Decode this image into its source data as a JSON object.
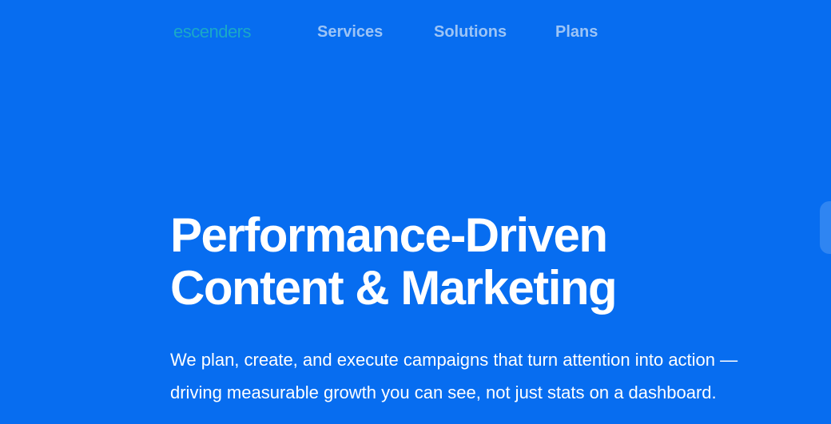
{
  "nav": {
    "logo": "escenders",
    "links": [
      {
        "label": "Services"
      },
      {
        "label": "Solutions"
      },
      {
        "label": "Plans"
      }
    ]
  },
  "hero": {
    "title_line1": "Performance-Driven",
    "title_line2": "Content & Marketing",
    "subtitle_line1": "We plan, create, and execute campaigns that turn attention into action —",
    "subtitle_line2": "driving measurable growth you can see, not just stats on a dashboard."
  },
  "colors": {
    "background": "#076df0",
    "logo": "#1aa8c8",
    "nav_link": "#9cc4f6",
    "text": "#ffffff"
  }
}
